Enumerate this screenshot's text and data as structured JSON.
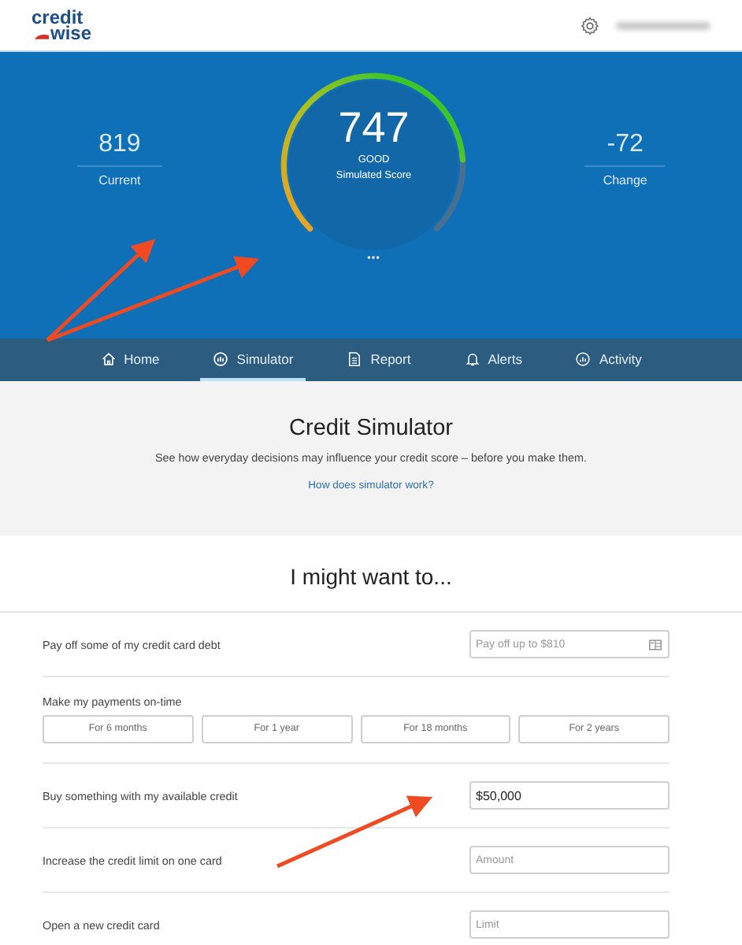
{
  "header": {
    "logo_top": "credit",
    "logo_bottom": "wise"
  },
  "hero": {
    "current": {
      "value": "819",
      "label": "Current"
    },
    "score": {
      "value": "747",
      "rating": "GOOD",
      "label": "Simulated Score"
    },
    "change": {
      "value": "-72",
      "label": "Change"
    }
  },
  "tabs": [
    {
      "label": "Home",
      "selected": false
    },
    {
      "label": "Simulator",
      "selected": true
    },
    {
      "label": "Report",
      "selected": false
    },
    {
      "label": "Alerts",
      "selected": false
    },
    {
      "label": "Activity",
      "selected": false
    }
  ],
  "intro": {
    "title": "Credit Simulator",
    "subtitle": "See how everyday decisions may influence your credit score – before you make them.",
    "link": "How does simulator work?"
  },
  "section_title": "I might want to...",
  "options": [
    {
      "kind": "input",
      "label": "Pay off some of my credit card debt",
      "placeholder": "Pay off up to $810"
    },
    {
      "kind": "choices",
      "label": "Make my payments on-time",
      "choices": [
        "For 6 months",
        "For 1 year",
        "For 18 months",
        "For 2 years"
      ]
    },
    {
      "kind": "input",
      "label": "Buy something with my available credit",
      "value": "$50,000"
    },
    {
      "kind": "input",
      "label": "Increase the credit limit on one card",
      "placeholder": "Amount"
    },
    {
      "kind": "input",
      "label": "Open a new credit card",
      "placeholder": "Limit"
    }
  ]
}
